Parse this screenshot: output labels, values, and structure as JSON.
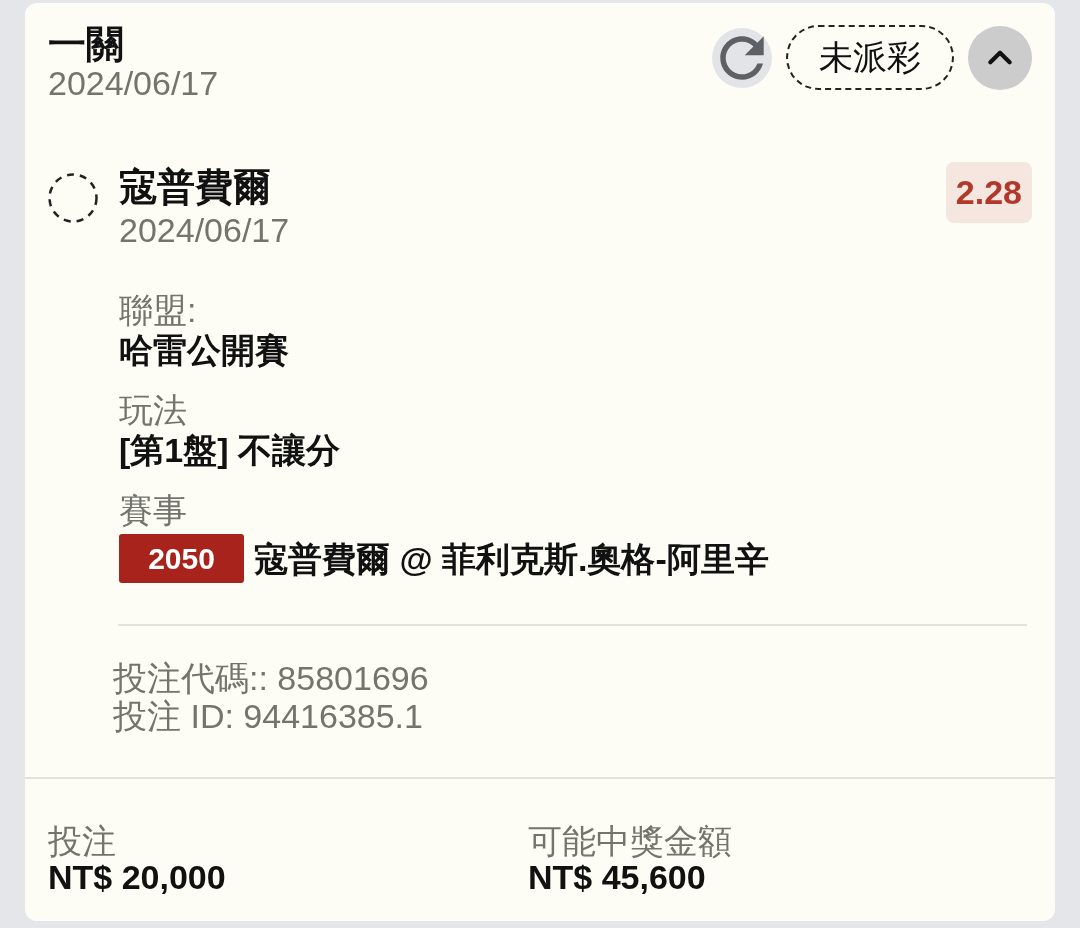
{
  "bet": {
    "title": "一關",
    "date": "2024/06/17",
    "status": {
      "label": "未派彩",
      "settled": false
    },
    "expanded": true
  },
  "selection": {
    "settled": false,
    "name": "寇普費爾",
    "date": "2024/06/17",
    "odds": "2.28",
    "details": [
      {
        "label": "聯盟:",
        "value": "哈雷公開賽"
      },
      {
        "label": "玩法",
        "value": "[第1盤] 不讓分"
      },
      {
        "label": "賽事",
        "value": "寇普費爾 @ 菲利克斯.奧格-阿里辛",
        "event_code": "2050"
      }
    ]
  },
  "references": [
    "投注代碼:: 85801696",
    "投注 ID: 94416385.1"
  ],
  "summary": [
    {
      "label": "投注",
      "amount": "NT$ 20,000"
    },
    {
      "label": "可能中獎金額",
      "amount": "NT$ 45,600"
    }
  ]
}
